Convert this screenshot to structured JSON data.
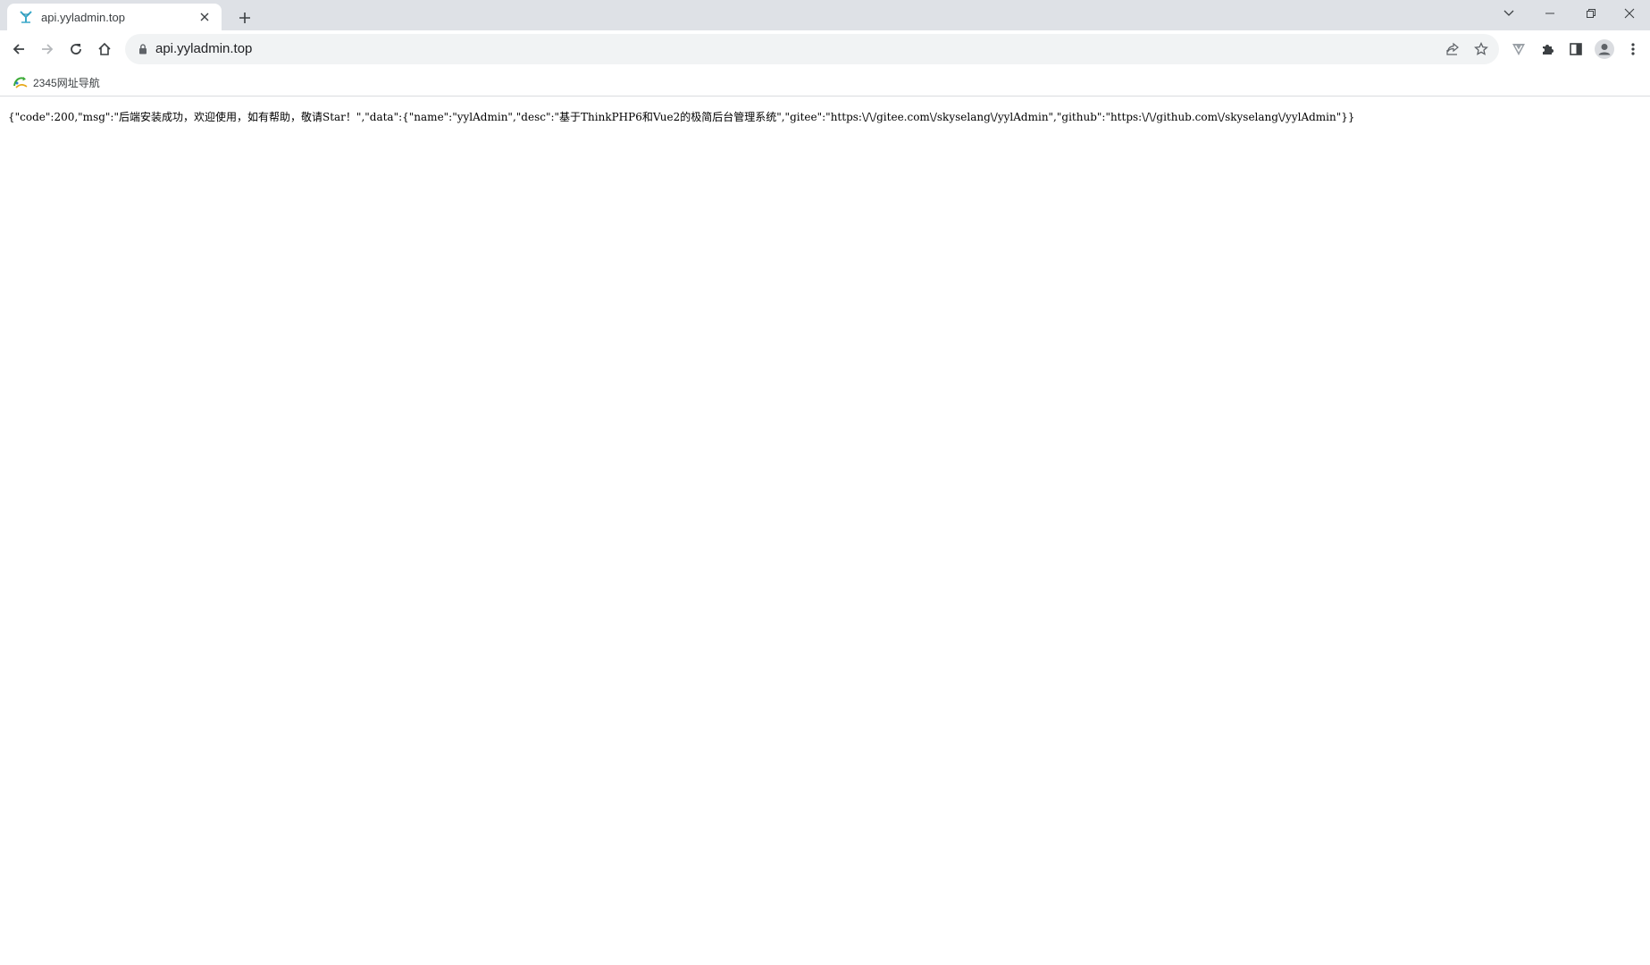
{
  "browser": {
    "tab": {
      "title": "api.yyladmin.top",
      "favicon": "yyladmin-logo-icon"
    },
    "address_bar": {
      "url": "api.yyladmin.top"
    },
    "bookmarks": [
      {
        "label": "2345网址导航",
        "icon": "2345-logo-icon"
      }
    ]
  },
  "page": {
    "body_text": "{\"code\":200,\"msg\":\"后端安装成功，欢迎使用，如有帮助，敬请Star！\",\"data\":{\"name\":\"yylAdmin\",\"desc\":\"基于ThinkPHP6和Vue2的极简后台管理系统\",\"gitee\":\"https:\\/\\/gitee.com\\/skyselang\\/yylAdmin\",\"github\":\"https:\\/\\/github.com\\/skyselang\\/yylAdmin\"}}"
  },
  "colors": {
    "tabstrip": "#dee1e6",
    "omnibox": "#f1f3f4",
    "icon": "#5f6368"
  }
}
